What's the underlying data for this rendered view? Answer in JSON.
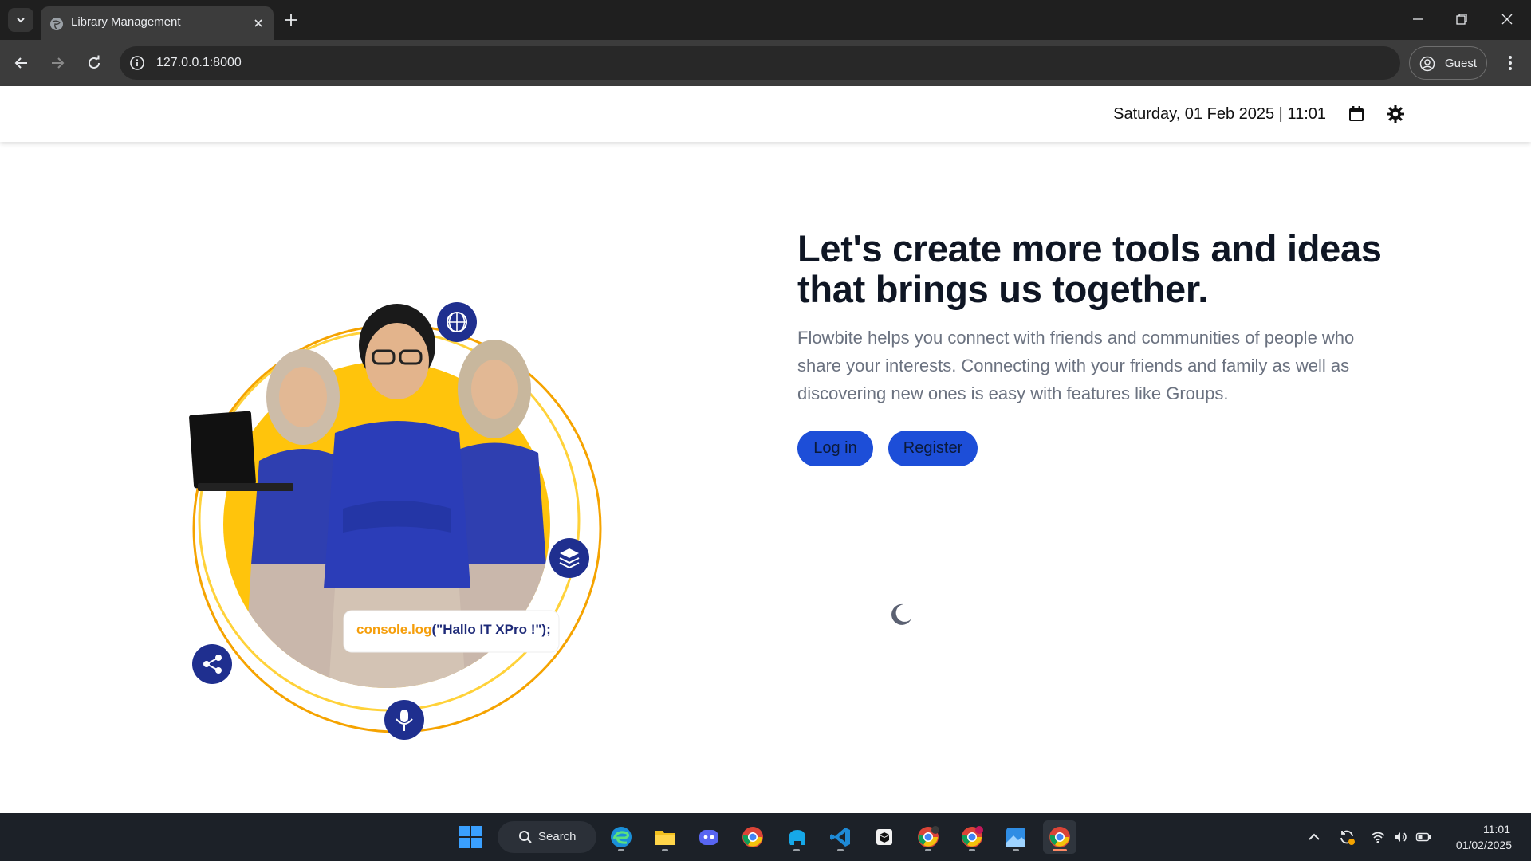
{
  "browser": {
    "tab_title": "Library Management",
    "url": "127.0.0.1:8000",
    "profile_label": "Guest"
  },
  "nav": {
    "datetime": "Saturday, 01 Feb 2025 | 11:01",
    "calendar_icon": "calendar-icon",
    "theme_icon": "sun-gear-icon"
  },
  "hero": {
    "title_line1": "Let's create more tools and ideas",
    "title_line2": "that brings us together.",
    "description": "Flowbite helps you connect with friends and communities of people who share your interests. Connecting with your friends and family as well as discovering new ones is easy with features like Groups.",
    "login_label": "Log in",
    "register_label": "Register",
    "code_badge_keyword": "console.log",
    "code_badge_args": "(\"Hallo IT XPro !\");",
    "accent_color": "#1d4ed8"
  },
  "taskbar": {
    "search_label": "Search",
    "time": "11:01",
    "date": "01/02/2025"
  }
}
